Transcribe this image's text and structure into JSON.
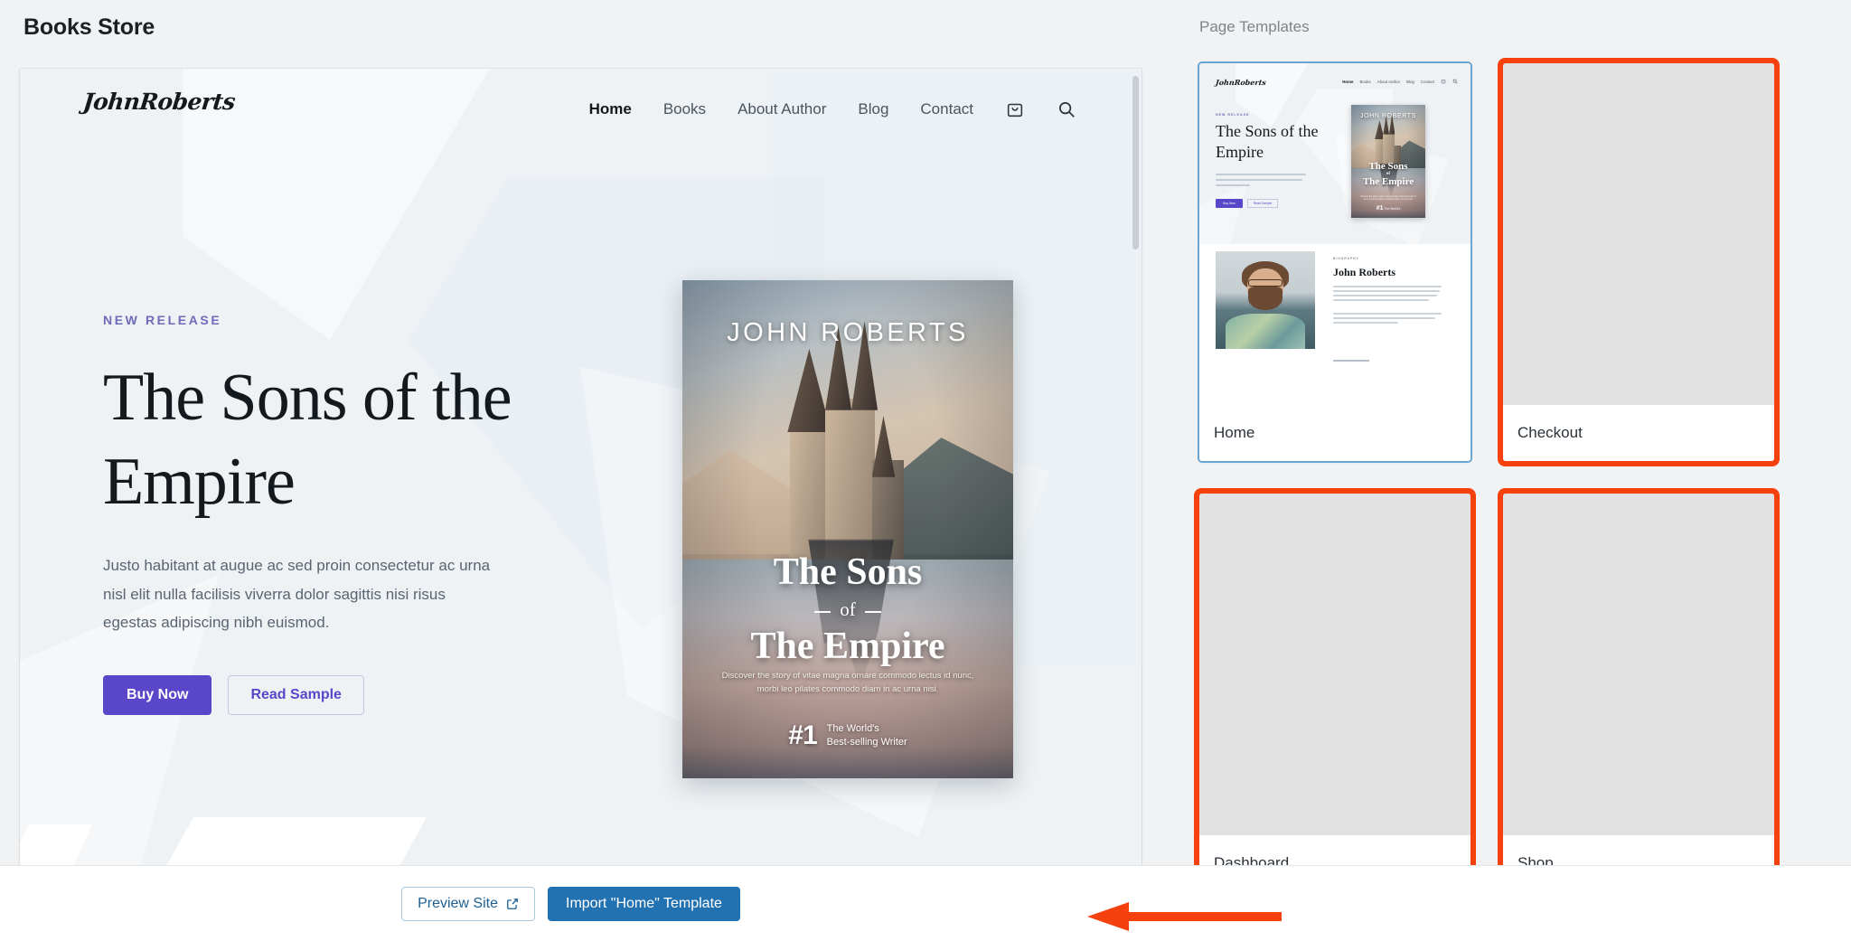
{
  "page": {
    "title": "Books Store"
  },
  "preview": {
    "site": {
      "logo": "JohnRoberts",
      "nav_links": [
        {
          "label": "Home",
          "active": true
        },
        {
          "label": "Books",
          "active": false
        },
        {
          "label": "About Author",
          "active": false
        },
        {
          "label": "Blog",
          "active": false
        },
        {
          "label": "Contact",
          "active": false
        }
      ],
      "nav_icons": [
        "shopping-bag-icon",
        "search-icon"
      ],
      "hero": {
        "eyebrow": "NEW RELEASE",
        "title_line1": "The Sons of the",
        "title_line2": "Empire",
        "description": "Justo habitant at augue ac sed proin consectetur ac urna nisl elit nulla facilisis viverra dolor sagittis nisi risus egestas adipiscing nibh euismod.",
        "primary_button": "Buy Now",
        "secondary_button": "Read Sample"
      },
      "book_cover": {
        "author": "JOHN ROBERTS",
        "title_line1": "The Sons",
        "title_connector": "of",
        "title_line2": "The Empire",
        "tagline": "Discover the story of vitae magna ornare commodo lectus id nunc, morbi leo pilates commodo diam in ac urna nisi.",
        "badge_number": "#1",
        "badge_line1": "The World's",
        "badge_line2": "Best-selling Writer"
      },
      "biography": {
        "eyebrow": "BIOGRAPHY",
        "name": "John Roberts"
      }
    },
    "scrollbar_present": true
  },
  "templates_panel": {
    "label": "Page Templates",
    "cards": [
      {
        "caption": "Home",
        "selected": true,
        "flagged": false,
        "has_thumbnail": true
      },
      {
        "caption": "Checkout",
        "selected": false,
        "flagged": true,
        "has_thumbnail": false
      },
      {
        "caption": "Dashboard",
        "selected": false,
        "flagged": true,
        "has_thumbnail": false
      },
      {
        "caption": "Shop",
        "selected": false,
        "flagged": true,
        "has_thumbnail": false
      }
    ]
  },
  "bottom_bar": {
    "preview_site_label": "Preview Site",
    "preview_site_icon": "external-link-icon",
    "import_label": "Import \"Home\" Template"
  },
  "annotations": {
    "arrow_color": "#F4410E",
    "highlight_border_color": "#F4410E",
    "arrow_points_to": "Import \"Home\" Template"
  },
  "colors": {
    "accent_purple": "#5A46C8",
    "accent_blue": "#2271B1",
    "selected_card_border": "#6AA6D4",
    "page_background": "#F0F2F4",
    "preview_background": "#EEF2F5"
  }
}
